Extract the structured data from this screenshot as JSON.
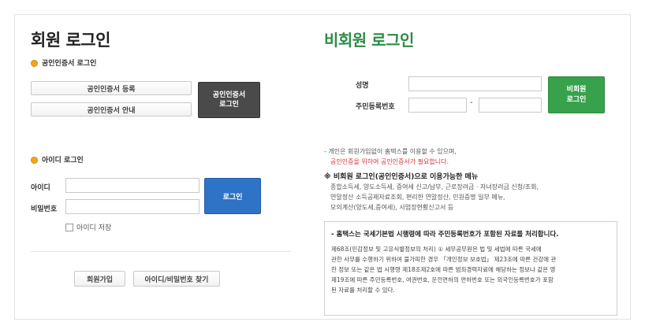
{
  "member": {
    "title": "회원 로그인",
    "cert_section": "공인인증서 로그인",
    "cert_register": "공인인증서 등록",
    "cert_guide": "공인인증서 안내",
    "cert_login": "공인인증서\n로그인",
    "id_section": "아이디 로그인",
    "id_label": "아이디",
    "pw_label": "비밀번호",
    "login_button": "로그인",
    "save_id": "아이디 저장",
    "join_button": "회원가입",
    "find_button": "아이디/비밀번호 찾기"
  },
  "guest": {
    "title": "비회원 로그인",
    "name_label": "성명",
    "rrn_label": "주민등록번호",
    "rrn_separator": "-",
    "login_button": "비회원\n로그인",
    "info_line1": "- 개인은 회원가입없이 홈택스를 이용할 수 있으며,",
    "info_line2_red": "공인인증을 위하여 공인인증서가 필요합니다.",
    "menu_title": "※ 비회원 로그인(공인인증서)으로 이용가능한 메뉴",
    "menu_line1": "종합소득세, 양도소득세, 증여세 신고/납부, 근로장려금 · 자녀장려금 신청/조회,",
    "menu_line2": "연말정산 소득공제자료조회, 편리한 연말정산, 민원증명 일부 메뉴,",
    "menu_line3": "모의계산(양도세,증여세), 사업장현황신고서 등",
    "notice_title": "- 홈택스는 국세기본법 시행령에 따라 주민등록번호가 포함된 자료를 처리합니다.",
    "notice_body1": "제68조(민감정보 및 고유식별정보의 처리) ① 세무공무원은 법 및 세법에 따른 국세에",
    "notice_body2": "관한 사무를 수행하기 위하여 불가피한 경우 「개인정보 보호법」 제23조에 따른 건강에 관",
    "notice_body3": "한 정보 또는 같은 법 시행령 제18조제2호에 따른 범죄경력자료에 해당하는 정보나 같은 영",
    "notice_body4": "제19조에 따른 주민등록번호, 여권번호, 운전면허의 면허번호 또는 외국인등록번호가 포함",
    "notice_body5": "된 자료를 처리할 수 있다."
  },
  "colors": {
    "accent_blue": "#2f73c6",
    "accent_green": "#37a24b",
    "guest_title": "#2e8b46",
    "dark_button": "#4a4a4a",
    "bullet": "#f2a51a",
    "red_text": "#dd3333"
  }
}
